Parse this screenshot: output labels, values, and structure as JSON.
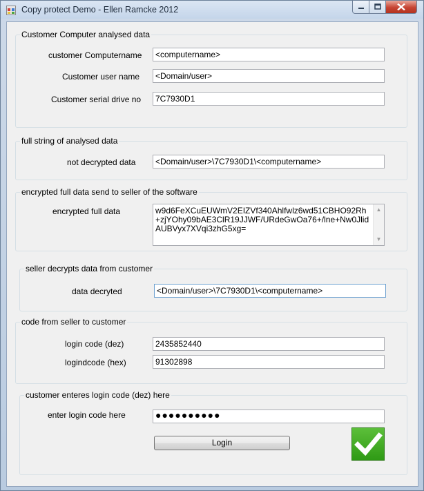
{
  "window": {
    "title": "Copy protect Demo  - Ellen Ramcke 2012"
  },
  "groups": {
    "analysed": {
      "title": "Customer Computer analysed data",
      "computername_label": "customer Computername",
      "computername_value": "<computername>",
      "username_label": "Customer user name",
      "username_value": "<Domain/user>",
      "serial_label": "Customer serial drive no",
      "serial_value": "7C7930D1"
    },
    "fullstring": {
      "title": "full string of analysed data",
      "not_decrypted_label": "not decrypted data",
      "not_decrypted_value": "<Domain/user>\\7C7930D1\\<computername>"
    },
    "encrypted": {
      "title": "encrypted full data send to seller of the software",
      "label": "encrypted full data",
      "value": "w9d6FeXCuEUWmV2EIZVf340Ahlfwlz6wd51CBHO92Rh+zjYOhy09bAE3ClR19JJWF/URdeGwOa76+/lne+Nw0JlidAUBVyx7XVqi3zhG5xg="
    },
    "seller_decrypt": {
      "title": "seller decrypts data from customer",
      "label": "data decryted",
      "value": "<Domain/user>\\7C7930D1\\<computername>"
    },
    "code": {
      "title": "code from seller to customer",
      "dez_label": "login code (dez)",
      "dez_value": "2435852440",
      "hex_label": "logindcode (hex)",
      "hex_value": "91302898"
    },
    "enter": {
      "title": "customer enteres login code (dez) here",
      "label": "enter login code here",
      "password_mask": "●●●●●●●●●●",
      "login_button": "Login"
    }
  },
  "status": {
    "success_icon": "checkmark-icon",
    "success_color": "#3aa321"
  },
  "colors": {
    "close_button": "#c64433",
    "titlebar": "#c4d5ea"
  }
}
